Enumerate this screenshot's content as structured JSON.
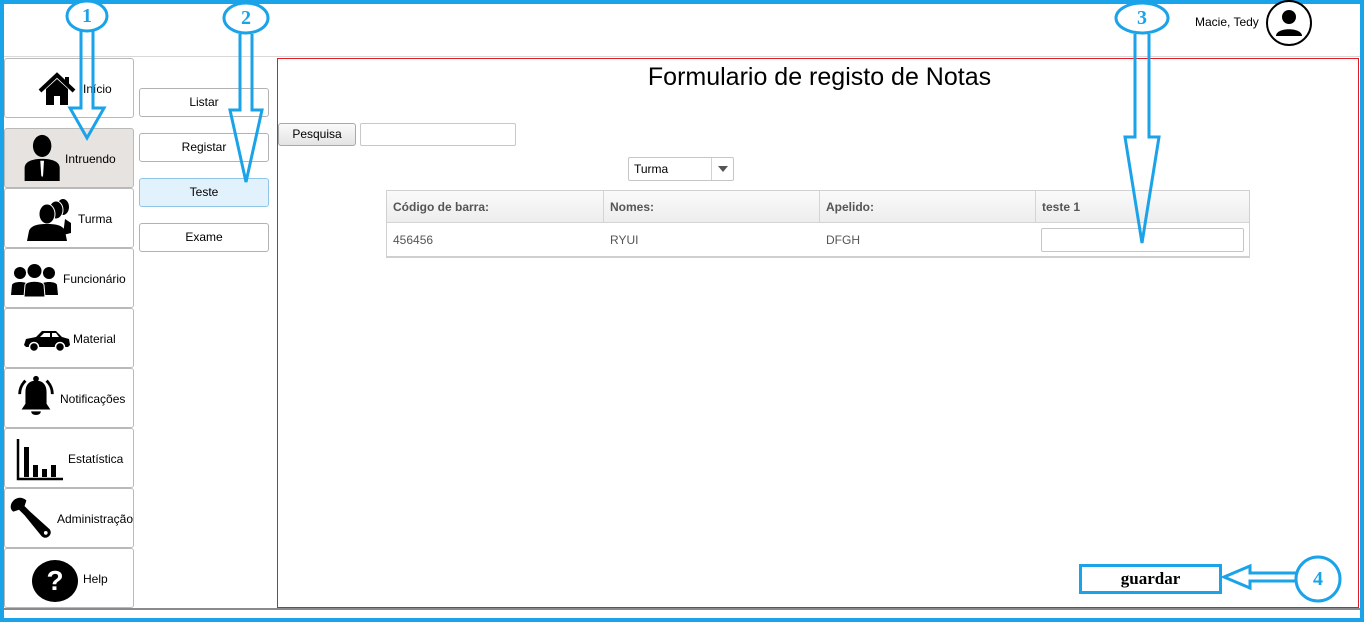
{
  "header": {
    "user_name": "Macie, Tedy",
    "avatar_icon": "user-avatar-icon"
  },
  "sidebar": {
    "items": [
      {
        "label": "Início",
        "icon": "home-icon",
        "active": false
      },
      {
        "label": "Intruendo",
        "icon": "student-icon",
        "active": true
      },
      {
        "label": "Turma",
        "icon": "group-icon",
        "active": false
      },
      {
        "label": "Funcionário",
        "icon": "staff-icon",
        "active": false
      },
      {
        "label": "Material",
        "icon": "car-icon",
        "active": false
      },
      {
        "label": "Notificações",
        "icon": "bell-icon",
        "active": false
      },
      {
        "label": "Estatística",
        "icon": "chart-icon",
        "active": false
      },
      {
        "label": "Administração",
        "icon": "wrench-icon",
        "active": false
      },
      {
        "label": "Help",
        "icon": "help-icon",
        "active": false
      }
    ]
  },
  "submenu": {
    "items": [
      {
        "label": "Listar",
        "active": false
      },
      {
        "label": "Registar",
        "active": false
      },
      {
        "label": "Teste",
        "active": true
      },
      {
        "label": "Exame",
        "active": false
      }
    ]
  },
  "main": {
    "title": "Formulario de registo de Notas",
    "search_label": "Pesquisa",
    "search_value": "",
    "select_value": "Turma",
    "table": {
      "columns": [
        "Código de barra:",
        "Nomes:",
        "Apelido:",
        "teste 1"
      ],
      "rows": [
        {
          "codigo": "456456",
          "nome": "RYUI",
          "apelido": "DFGH",
          "teste1": ""
        }
      ]
    },
    "save_label": "guardar"
  },
  "annotations": {
    "labels": [
      "1",
      "2",
      "3",
      "4"
    ],
    "color": "#1aa3e8"
  },
  "colors": {
    "accent": "#1aa3e8",
    "panel_border": "#e01b24",
    "active_item": "#e7e3e1",
    "active_sub": "#e2f2fc"
  }
}
